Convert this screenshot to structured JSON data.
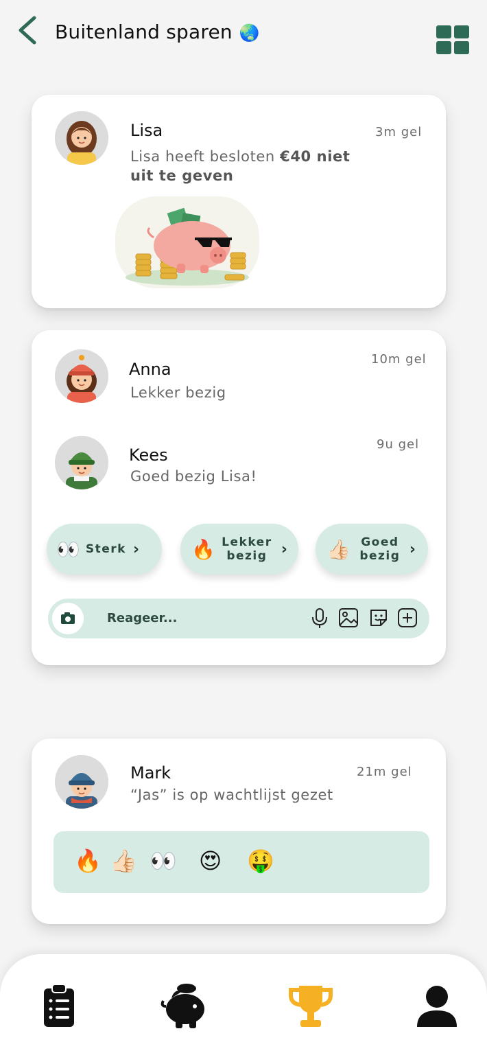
{
  "header": {
    "title": "Buitenland sparen",
    "title_emoji": "🌏",
    "accent_color": "#2d6b57"
  },
  "feed": {
    "post1": {
      "name": "Lisa",
      "time": "3m gel",
      "message_prefix": "Lisa heeft besloten ",
      "message_bold": "€40 niet uit te geven"
    },
    "post2": {
      "comments": [
        {
          "name": "Anna",
          "time": "10m gel",
          "text": "Lekker bezig"
        },
        {
          "name": "Kees",
          "time": "9u gel",
          "text": "Goed bezig Lisa!"
        }
      ],
      "quick_reactions": [
        {
          "emoji": "👀",
          "label": "Sterk"
        },
        {
          "emoji": "🔥",
          "label": "Lekker bezig"
        },
        {
          "emoji": "👍🏻",
          "label": "Goed bezig"
        }
      ],
      "reply_placeholder": "Reageer..."
    },
    "post3": {
      "name": "Mark",
      "time": "21m gel",
      "text": "“Jas” is op wachtlijst gezet",
      "reactions": [
        "🔥",
        "👍🏻",
        "👀",
        "😍",
        "🤑"
      ]
    }
  },
  "tabbar": {
    "icons": [
      "clipboard-list-icon",
      "piggy-bank-icon",
      "trophy-icon",
      "user-icon"
    ],
    "active_index": 2,
    "active_color": "#f5b123"
  }
}
